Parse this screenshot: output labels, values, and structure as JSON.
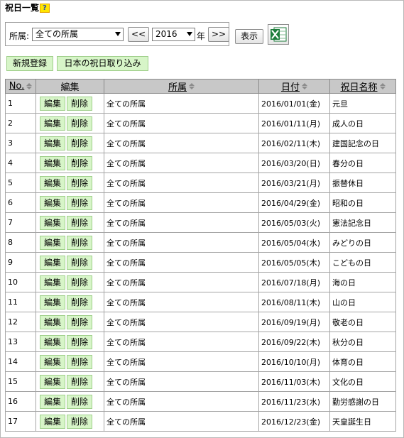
{
  "page": {
    "title": "祝日一覧",
    "help_label": "?"
  },
  "filter": {
    "affiliation_label": "所属:",
    "affiliation_value": "全ての所属",
    "prev_label": "<<",
    "year_value": "2016",
    "year_unit": "年",
    "next_label": ">>",
    "show_label": "表示"
  },
  "actions": {
    "new_label": "新規登録",
    "import_label": "日本の祝日取り込み"
  },
  "table": {
    "headers": {
      "no": "No.",
      "edit": "編集",
      "affiliation": "所属",
      "date": "日付",
      "name": "祝日名称"
    },
    "edit_label": "編集",
    "delete_label": "削除",
    "rows": [
      {
        "no": "1",
        "affiliation": "全ての所属",
        "date": "2016/01/01(金)",
        "name": "元旦"
      },
      {
        "no": "2",
        "affiliation": "全ての所属",
        "date": "2016/01/11(月)",
        "name": "成人の日"
      },
      {
        "no": "3",
        "affiliation": "全ての所属",
        "date": "2016/02/11(木)",
        "name": "建国記念の日"
      },
      {
        "no": "4",
        "affiliation": "全ての所属",
        "date": "2016/03/20(日)",
        "name": "春分の日"
      },
      {
        "no": "5",
        "affiliation": "全ての所属",
        "date": "2016/03/21(月)",
        "name": "振替休日"
      },
      {
        "no": "6",
        "affiliation": "全ての所属",
        "date": "2016/04/29(金)",
        "name": "昭和の日"
      },
      {
        "no": "7",
        "affiliation": "全ての所属",
        "date": "2016/05/03(火)",
        "name": "憲法記念日"
      },
      {
        "no": "8",
        "affiliation": "全ての所属",
        "date": "2016/05/04(水)",
        "name": "みどりの日"
      },
      {
        "no": "9",
        "affiliation": "全ての所属",
        "date": "2016/05/05(木)",
        "name": "こどもの日"
      },
      {
        "no": "10",
        "affiliation": "全ての所属",
        "date": "2016/07/18(月)",
        "name": "海の日"
      },
      {
        "no": "11",
        "affiliation": "全ての所属",
        "date": "2016/08/11(木)",
        "name": "山の日"
      },
      {
        "no": "12",
        "affiliation": "全ての所属",
        "date": "2016/09/19(月)",
        "name": "敬老の日"
      },
      {
        "no": "13",
        "affiliation": "全ての所属",
        "date": "2016/09/22(木)",
        "name": "秋分の日"
      },
      {
        "no": "14",
        "affiliation": "全ての所属",
        "date": "2016/10/10(月)",
        "name": "体育の日"
      },
      {
        "no": "15",
        "affiliation": "全ての所属",
        "date": "2016/11/03(木)",
        "name": "文化の日"
      },
      {
        "no": "16",
        "affiliation": "全ての所属",
        "date": "2016/11/23(水)",
        "name": "勤労感謝の日"
      },
      {
        "no": "17",
        "affiliation": "全ての所属",
        "date": "2016/12/23(金)",
        "name": "天皇誕生日"
      }
    ]
  },
  "colors": {
    "button_green": "#d7f5c8",
    "header_gray": "#c8c8c8",
    "help_yellow": "#ffe600",
    "excel_green": "#1e7d3c"
  },
  "icons": {
    "excel": "excel-export-icon",
    "sort": "sort-icon",
    "dropdown": "chevron-down-icon"
  }
}
